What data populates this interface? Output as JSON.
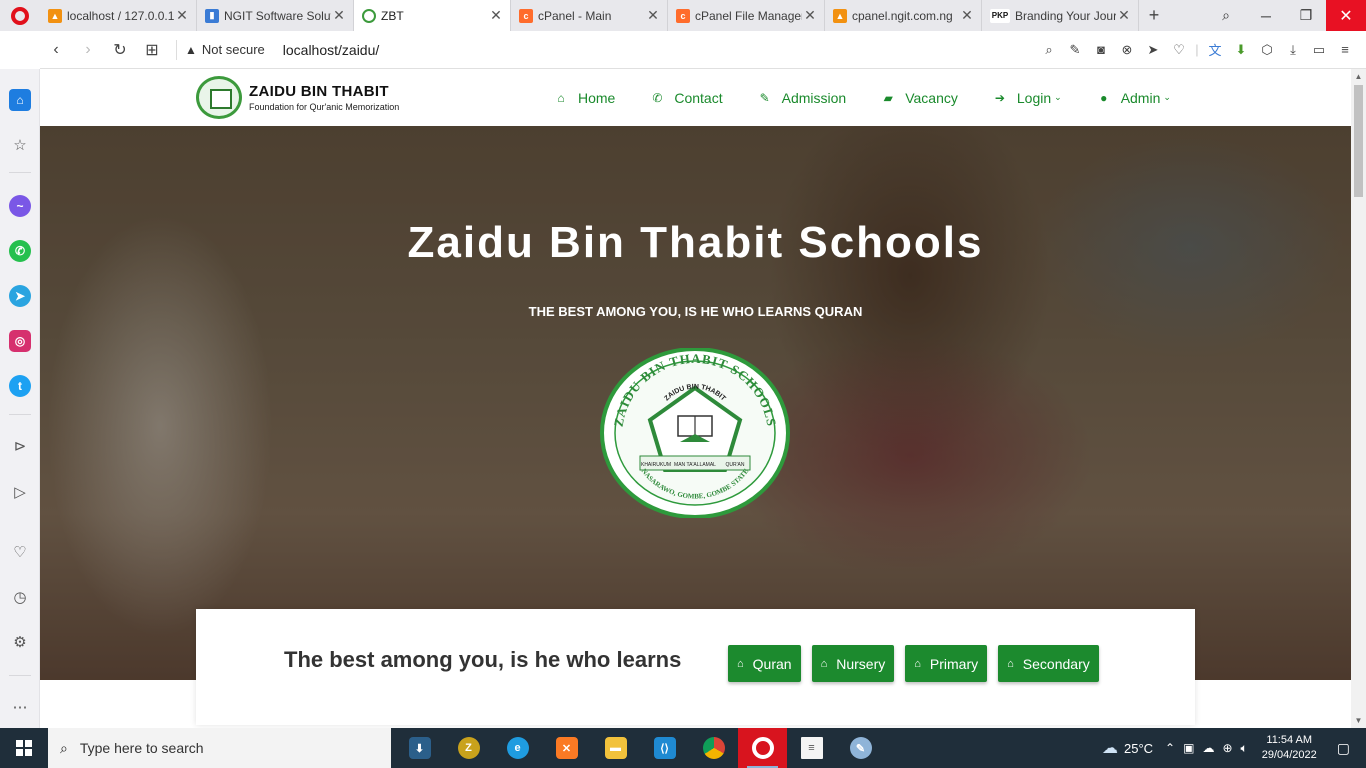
{
  "browser": {
    "tabs": [
      {
        "label": "localhost / 127.0.0.1",
        "favicon": "phpmyadmin-icon",
        "color": "#f29111",
        "active": false
      },
      {
        "label": "NGIT Software Solutions",
        "favicon": "ngit-icon",
        "color": "#3a7bd5",
        "active": false
      },
      {
        "label": "ZBT",
        "favicon": "zbt-icon",
        "color": "#3c9a3c",
        "active": true
      },
      {
        "label": "cPanel - Main",
        "favicon": "cpanel-icon",
        "color": "#ff6c2c",
        "active": false
      },
      {
        "label": "cPanel File Manager",
        "favicon": "cpanel-icon",
        "color": "#ff6c2c",
        "active": false
      },
      {
        "label": "cpanel.ngit.com.ng",
        "favicon": "phpmyadmin-icon",
        "color": "#f29111",
        "active": false
      },
      {
        "label": "Branding Your Journal",
        "favicon": "pkp-icon",
        "color": "#222222",
        "active": false
      }
    ],
    "pkp_text": "PKP",
    "security": "Not secure",
    "url": "localhost/zaidu/"
  },
  "site": {
    "brand": {
      "title": "ZAIDU BIN THABIT",
      "subtitle": "Foundation for Qur'anic Memorization"
    },
    "menu": [
      {
        "label": "Home",
        "icon": "home-icon",
        "dropdown": false
      },
      {
        "label": "Contact",
        "icon": "phone-icon",
        "dropdown": false
      },
      {
        "label": "Admission",
        "icon": "edit-icon",
        "dropdown": false
      },
      {
        "label": "Vacancy",
        "icon": "graduation-cap-icon",
        "dropdown": false
      },
      {
        "label": "Login",
        "icon": "sign-in-icon",
        "dropdown": true
      },
      {
        "label": "Admin",
        "icon": "user-icon",
        "dropdown": true
      }
    ],
    "hero": {
      "title": "Zaidu Bin Thabit Schools",
      "tagline": "THE BEST AMONG YOU, IS HE WHO LEARNS QURAN",
      "seal_text": {
        "outer_top": "ZAIDU BIN THABIT SCHOOLS",
        "inner_top": "ZAIDU BIN THABIT",
        "ribbon_left": "KHAIRUKUM",
        "ribbon_center": "MAN TA'ALLAMAL",
        "ribbon_right": "QUR'AN",
        "outer_bottom": "NASARAWO, GOMBE, GOMBE STATE"
      }
    },
    "programs": {
      "heading": "The best among you, is he who learns",
      "buttons": [
        "Quran",
        "Nursery",
        "Primary",
        "Secondary"
      ]
    }
  },
  "taskbar": {
    "search_placeholder": "Type here to search",
    "temperature": "25°C",
    "time": "11:54 AM",
    "date": "29/04/2022"
  },
  "colors": {
    "brand_green": "#1c8a2e",
    "menu_green": "#1a8a2c"
  }
}
